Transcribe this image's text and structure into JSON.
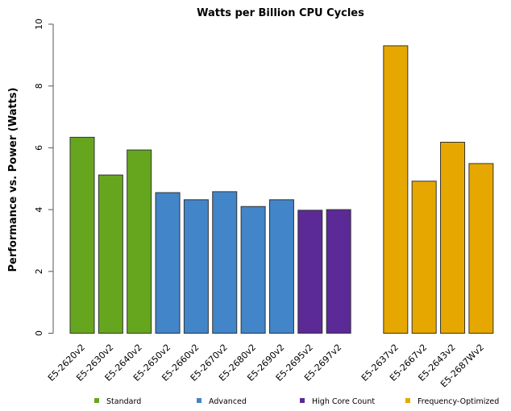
{
  "chart_data": {
    "type": "bar",
    "title": "Watts per Billion CPU Cycles",
    "xlabel": "",
    "ylabel": "Performance vs. Power (Watts)",
    "ylim": [
      0,
      10
    ],
    "yticks": [
      0,
      2,
      4,
      6,
      8,
      10
    ],
    "grid": false,
    "legend_placement": "bottom",
    "categories": [
      "E5-2620v2",
      "E5-2630v2",
      "E5-2640v2",
      "E5-2650v2",
      "E5-2660v2",
      "E5-2670v2",
      "E5-2680v2",
      "E5-2690v2",
      "E5-2695v2",
      "E5-2697v2",
      "",
      "E5-2637v2",
      "E5-2667v2",
      "E5-2643v2",
      "E5-2687Wv2"
    ],
    "values": [
      6.34,
      5.12,
      5.93,
      4.55,
      4.32,
      4.58,
      4.1,
      4.32,
      3.98,
      4.0,
      null,
      9.3,
      4.92,
      6.18,
      5.49
    ],
    "groups": [
      "Standard",
      "Standard",
      "Standard",
      "Advanced",
      "Advanced",
      "Advanced",
      "Advanced",
      "Advanced",
      "High Core Count",
      "High Core Count",
      null,
      "Frequency-Optimized",
      "Frequency-Optimized",
      "Frequency-Optimized",
      "Frequency-Optimized"
    ],
    "legend": [
      {
        "name": "Standard",
        "color": "#66a61e"
      },
      {
        "name": "Advanced",
        "color": "#4285c8"
      },
      {
        "name": "High Core Count",
        "color": "#5b2a96"
      },
      {
        "name": "Frequency-Optimized",
        "color": "#e6a800"
      }
    ]
  }
}
